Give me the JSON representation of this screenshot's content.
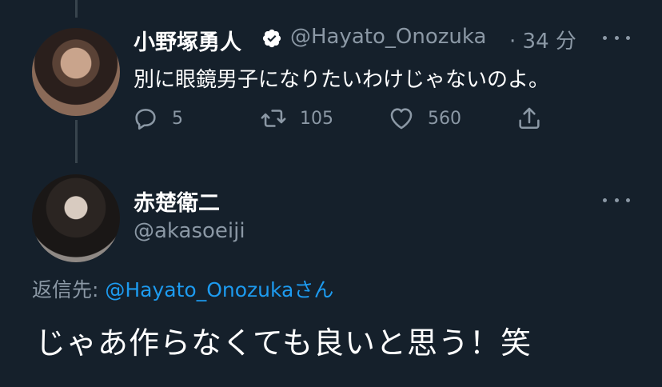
{
  "tweet1": {
    "display_name": "小野塚勇人",
    "handle": "@Hayato_Onozuka",
    "time": "· 34 分",
    "text": "別に眼鏡男子になりたいわけじゃないのよ。",
    "reply_count": "5",
    "retweet_count": "105",
    "like_count": "560"
  },
  "tweet2": {
    "display_name": "赤楚衛二",
    "handle": "@akasoeiji",
    "reply_prefix": "返信先: ",
    "reply_mention": "@Hayato_Onozuka",
    "reply_suffix": "さん",
    "text": "じゃあ作らなくても良いと思う！笑"
  },
  "colors": {
    "background": "#15202b",
    "secondary_text": "#8b98a5",
    "accent": "#1d9bf0"
  }
}
